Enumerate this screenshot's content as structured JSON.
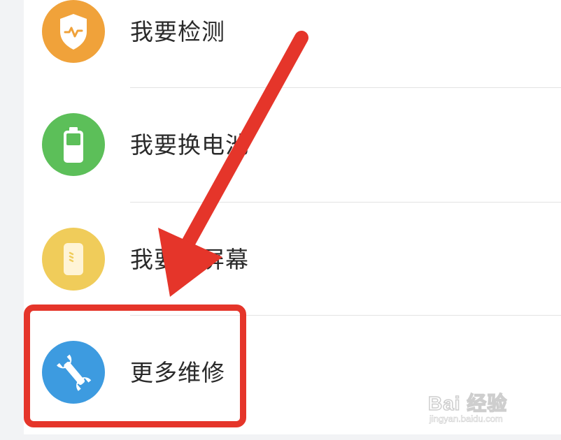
{
  "menu": {
    "items": [
      {
        "label": "我要检测",
        "icon": "shield-pulse-icon",
        "color": "#f0a23a"
      },
      {
        "label": "我要换电池",
        "icon": "battery-icon",
        "color": "#5cbf59"
      },
      {
        "label": "我要换屏幕",
        "icon": "phone-screen-icon",
        "color": "#f0cc5a"
      },
      {
        "label": "更多维修",
        "icon": "wrench-icon",
        "color": "#3d9be0"
      }
    ]
  },
  "annotation": {
    "color": "#e5352a"
  },
  "watermark": {
    "logo": "Bai 经验",
    "url": "jingyan.baidu.com"
  }
}
